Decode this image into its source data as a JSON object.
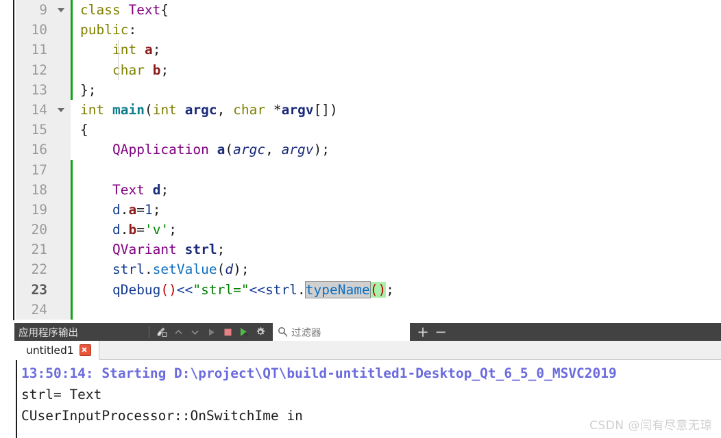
{
  "editor": {
    "lines": [
      {
        "num": "9",
        "fold": true,
        "change": true,
        "indent": false,
        "tokens": [
          {
            "t": "class ",
            "c": "kw"
          },
          {
            "t": "Text",
            "c": "type var-bold"
          },
          {
            "t": "{",
            "c": "plain"
          }
        ]
      },
      {
        "num": "10",
        "fold": false,
        "change": true,
        "indent": false,
        "tokens": [
          {
            "t": "public",
            "c": "kw"
          },
          {
            "t": ":",
            "c": "plain"
          }
        ]
      },
      {
        "num": "11",
        "fold": false,
        "change": true,
        "indent": true,
        "tokens": [
          {
            "t": "    ",
            "c": "plain"
          },
          {
            "t": "int",
            "c": "kw"
          },
          {
            "t": " ",
            "c": "plain"
          },
          {
            "t": "a",
            "c": "var-red"
          },
          {
            "t": ";",
            "c": "plain"
          }
        ]
      },
      {
        "num": "12",
        "fold": false,
        "change": true,
        "indent": true,
        "tokens": [
          {
            "t": "    ",
            "c": "plain"
          },
          {
            "t": "char",
            "c": "kw"
          },
          {
            "t": " ",
            "c": "plain"
          },
          {
            "t": "b",
            "c": "var-red"
          },
          {
            "t": ";",
            "c": "plain"
          }
        ]
      },
      {
        "num": "13",
        "fold": false,
        "change": true,
        "indent": false,
        "tokens": [
          {
            "t": "};",
            "c": "plain"
          }
        ]
      },
      {
        "num": "14",
        "fold": true,
        "change": false,
        "indent": false,
        "tokens": [
          {
            "t": "int",
            "c": "kw"
          },
          {
            "t": " ",
            "c": "plain"
          },
          {
            "t": "main",
            "c": "fn"
          },
          {
            "t": "(",
            "c": "plain"
          },
          {
            "t": "int",
            "c": "kw"
          },
          {
            "t": " ",
            "c": "plain"
          },
          {
            "t": "argc",
            "c": "var"
          },
          {
            "t": ", ",
            "c": "plain"
          },
          {
            "t": "char",
            "c": "kw"
          },
          {
            "t": " *",
            "c": "plain"
          },
          {
            "t": "argv",
            "c": "var"
          },
          {
            "t": "[])",
            "c": "plain"
          }
        ]
      },
      {
        "num": "15",
        "fold": false,
        "change": false,
        "indent": false,
        "tokens": [
          {
            "t": "{",
            "c": "plain"
          }
        ]
      },
      {
        "num": "16",
        "fold": false,
        "change": false,
        "indent": false,
        "tokens": [
          {
            "t": "    ",
            "c": "plain"
          },
          {
            "t": "QApplication",
            "c": "type"
          },
          {
            "t": " ",
            "c": "plain"
          },
          {
            "t": "a",
            "c": "var"
          },
          {
            "t": "(",
            "c": "plain"
          },
          {
            "t": "argc",
            "c": "param"
          },
          {
            "t": ", ",
            "c": "plain"
          },
          {
            "t": "argv",
            "c": "param"
          },
          {
            "t": ");",
            "c": "plain"
          }
        ]
      },
      {
        "num": "17",
        "fold": false,
        "change": true,
        "indent": false,
        "tokens": []
      },
      {
        "num": "18",
        "fold": false,
        "change": true,
        "indent": false,
        "tokens": [
          {
            "t": "    ",
            "c": "plain"
          },
          {
            "t": "Text",
            "c": "type"
          },
          {
            "t": " ",
            "c": "plain"
          },
          {
            "t": "d",
            "c": "var"
          },
          {
            "t": ";",
            "c": "plain"
          }
        ]
      },
      {
        "num": "19",
        "fold": false,
        "change": true,
        "indent": false,
        "tokens": [
          {
            "t": "    ",
            "c": "plain"
          },
          {
            "t": "d",
            "c": "nav"
          },
          {
            "t": ".",
            "c": "plain"
          },
          {
            "t": "a",
            "c": "var-red"
          },
          {
            "t": "=",
            "c": "plain"
          },
          {
            "t": "1",
            "c": "num"
          },
          {
            "t": ";",
            "c": "plain"
          }
        ]
      },
      {
        "num": "20",
        "fold": false,
        "change": true,
        "indent": false,
        "tokens": [
          {
            "t": "    ",
            "c": "plain"
          },
          {
            "t": "d",
            "c": "nav"
          },
          {
            "t": ".",
            "c": "plain"
          },
          {
            "t": "b",
            "c": "var-red"
          },
          {
            "t": "=",
            "c": "plain"
          },
          {
            "t": "'v'",
            "c": "str"
          },
          {
            "t": ";",
            "c": "plain"
          }
        ]
      },
      {
        "num": "21",
        "fold": false,
        "change": true,
        "indent": false,
        "tokens": [
          {
            "t": "    ",
            "c": "plain"
          },
          {
            "t": "QVariant",
            "c": "type"
          },
          {
            "t": " ",
            "c": "plain"
          },
          {
            "t": "strl",
            "c": "var"
          },
          {
            "t": ";",
            "c": "plain"
          }
        ]
      },
      {
        "num": "22",
        "fold": false,
        "change": true,
        "indent": false,
        "tokens": [
          {
            "t": "    ",
            "c": "plain"
          },
          {
            "t": "strl",
            "c": "nav"
          },
          {
            "t": ".",
            "c": "plain"
          },
          {
            "t": "setValue",
            "c": "mem"
          },
          {
            "t": "(",
            "c": "plain"
          },
          {
            "t": "d",
            "c": "param"
          },
          {
            "t": ");",
            "c": "plain"
          }
        ]
      },
      {
        "num": "23",
        "fold": false,
        "change": true,
        "indent": false,
        "current": true,
        "tokens": [
          {
            "t": "    ",
            "c": "plain"
          },
          {
            "t": "qDebug",
            "c": "nav"
          },
          {
            "t": "()",
            "c": "paren"
          },
          {
            "t": "<<",
            "c": "op"
          },
          {
            "t": "\"strl=\"",
            "c": "str"
          },
          {
            "t": "<<",
            "c": "op"
          },
          {
            "t": "strl",
            "c": "nav"
          },
          {
            "t": ".",
            "c": "plain"
          },
          {
            "t": "typeName",
            "c": "mem sel"
          },
          {
            "t": "()",
            "c": "paren greenhl"
          },
          {
            "t": ";",
            "c": "plain"
          }
        ]
      },
      {
        "num": "24",
        "fold": false,
        "change": true,
        "indent": false,
        "tokens": []
      }
    ]
  },
  "panel": {
    "title": "应用程序输出",
    "toolbar_icons": [
      {
        "name": "clear-pane-icon",
        "glyph": "broom"
      },
      {
        "name": "previous-item-icon",
        "glyph": "chevron-up"
      },
      {
        "name": "next-item-icon",
        "glyph": "chevron-down"
      },
      {
        "name": "run-icon",
        "glyph": "play"
      },
      {
        "name": "stop-icon",
        "glyph": "stop-square"
      },
      {
        "name": "attach-debugger-icon",
        "glyph": "play-debug"
      },
      {
        "name": "settings-icon",
        "glyph": "gear"
      }
    ],
    "filter": {
      "placeholder": "过滤器",
      "value": "",
      "icon": "search-icon"
    },
    "zoom_in_label": "+",
    "zoom_out_label": "−",
    "tabs": [
      {
        "label": "untitled1",
        "active": true,
        "closable": true
      }
    ],
    "output_lines": [
      {
        "text": "13:50:14: Starting D:\\project\\QT\\build-untitled1-Desktop_Qt_6_5_0_MSVC2019",
        "style": "start"
      },
      {
        "text": "strl= Text",
        "style": "norm"
      },
      {
        "text": "CUserInputProcessor::OnSwitchIme in",
        "style": "norm"
      }
    ]
  },
  "watermark": {
    "text": "CSDN @闫有尽意无琼"
  },
  "colors": {
    "panel_toolbar_bg": "#424242",
    "change_bar": "#12a112",
    "gutter_bg": "#eeeeee",
    "tab_close": "#e8553a",
    "output_start": "#6b6bdd",
    "selection": "#d0d0d0",
    "green_highlight": "#aaf0aa"
  }
}
